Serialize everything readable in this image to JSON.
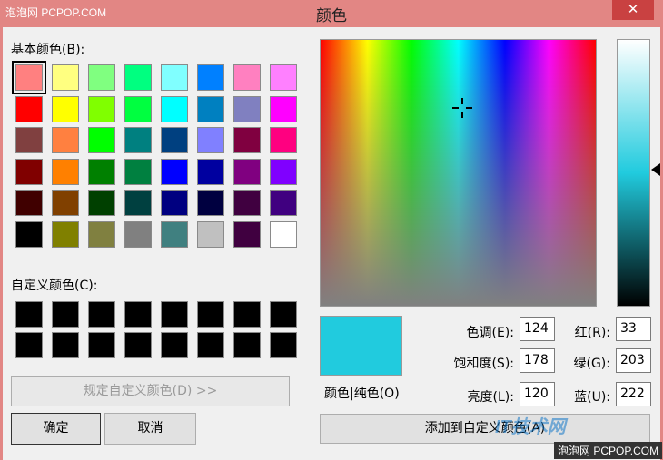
{
  "titlebar": {
    "watermark": "泡泡网 PCPOP.COM",
    "title": "颜色",
    "close": "✕"
  },
  "basic_colors": {
    "label": "基本颜色(B):",
    "rows": [
      [
        "#ff8080",
        "#ffff80",
        "#80ff80",
        "#00ff80",
        "#80ffff",
        "#0080ff",
        "#ff80c0",
        "#ff80ff"
      ],
      [
        "#ff0000",
        "#ffff00",
        "#80ff00",
        "#00ff40",
        "#00ffff",
        "#0080c0",
        "#8080c0",
        "#ff00ff"
      ],
      [
        "#804040",
        "#ff8040",
        "#00ff00",
        "#008080",
        "#004080",
        "#8080ff",
        "#800040",
        "#ff0080"
      ],
      [
        "#800000",
        "#ff8000",
        "#008000",
        "#008040",
        "#0000ff",
        "#0000a0",
        "#800080",
        "#8000ff"
      ],
      [
        "#400000",
        "#804000",
        "#004000",
        "#004040",
        "#000080",
        "#000040",
        "#400040",
        "#400080"
      ],
      [
        "#000000",
        "#808000",
        "#808040",
        "#808080",
        "#408080",
        "#c0c0c0",
        "#400040",
        "#ffffff"
      ]
    ]
  },
  "custom_colors": {
    "label": "自定义颜色(C):",
    "rows": [
      [
        "#000000",
        "#000000",
        "#000000",
        "#000000",
        "#000000",
        "#000000",
        "#000000",
        "#000000"
      ],
      [
        "#000000",
        "#000000",
        "#000000",
        "#000000",
        "#000000",
        "#000000",
        "#000000",
        "#000000"
      ]
    ]
  },
  "buttons": {
    "define_custom": "规定自定义颜色(D) >>",
    "ok": "确定",
    "cancel": "取消",
    "add_custom": "添加到自定义颜色(A)"
  },
  "preview": {
    "color": "#21cbde",
    "label": "颜色|纯色(O)"
  },
  "fields": {
    "hue_label": "色调(E):",
    "hue": "124",
    "sat_label": "饱和度(S):",
    "sat": "178",
    "lum_label": "亮度(L):",
    "lum": "120",
    "red_label": "红(R):",
    "red": "33",
    "green_label": "绿(G):",
    "green": "203",
    "blue_label": "蓝(U):",
    "blue": "222"
  },
  "watermarks": {
    "logo": "IT技术网",
    "bottom": "泡泡网 PCPOP.COM"
  }
}
